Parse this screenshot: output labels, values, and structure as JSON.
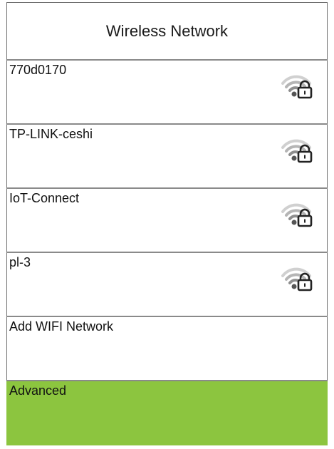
{
  "header": {
    "title": "Wireless Network"
  },
  "networks": [
    {
      "ssid": "770d0170",
      "icon": "wifi-locked-icon"
    },
    {
      "ssid": "TP-LINK-ceshi",
      "icon": "wifi-locked-icon"
    },
    {
      "ssid": "IoT-Connect",
      "icon": "wifi-locked-icon"
    },
    {
      "ssid": "pl-3",
      "icon": "wifi-locked-icon"
    }
  ],
  "actions": {
    "add_network": "Add WIFI Network",
    "advanced": "Advanced"
  },
  "colors": {
    "advanced_bg": "#8cc53f",
    "border": "#8a8a8a",
    "wifi_arc_light": "#cfcfcf",
    "wifi_arc_dark": "#7a7a7a"
  }
}
